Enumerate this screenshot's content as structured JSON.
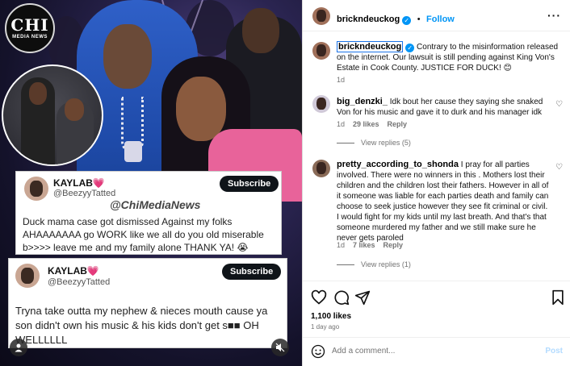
{
  "media": {
    "logo": {
      "main": "CHI",
      "sub": "MEDIA NEWS"
    },
    "watermark": "@ChiMediaNews",
    "tweets": [
      {
        "name": "KAYLAB💗",
        "handle": "@BeezyyTatted",
        "subscribe": "Subscribe",
        "body": "Duck mama case got dismissed Against my folks AHAAAAAAA go WORK like we all do you old miserable b>>>> leave me and my family alone THANK YA! 😭"
      },
      {
        "name": "KAYLAB💗",
        "handle": "@BeezyyTatted",
        "subscribe": "Subscribe",
        "body": "Tryna take outta my nephew & nieces mouth cause ya son didn't own his music & his kids don't get s■■ OH WELLLLLL"
      }
    ]
  },
  "post": {
    "username": "brickndeuckog",
    "follow_label": "Follow",
    "more_icon": "more-options-icon",
    "comments": [
      {
        "username": "brickndeuckog",
        "text": "Contrary to the misinformation released on the internet. Our lawsuit is still pending against King Von's Estate in Cook County. JUSTICE FOR DUCK! 😊",
        "time": "1d"
      },
      {
        "username": "big_denzki_",
        "text": "Idk bout her cause they saying she snaked Von for his music and gave it to durk and his manager idk",
        "time": "1d",
        "likes": "29 likes",
        "reply": "Reply",
        "view_replies": "View replies (5)"
      },
      {
        "username": "pretty_according_to_shonda",
        "text": "I pray for all parties involved. There were no winners in this . Mothers lost their children and the children lost their fathers. However in all of it someone was liable for each parties death and family can choose to seek justice however they see fit criminal or civil. I would fight for my kids until my last breath. And that's that someone murdered my father and we still make sure he never gets paroled",
        "time": "1d",
        "likes": "7 likes",
        "reply": "Reply",
        "view_replies": "View replies (1)"
      }
    ],
    "likes": "1,100 likes",
    "posted": "1 day ago",
    "add_comment_placeholder": "Add a comment...",
    "post_label": "Post"
  }
}
